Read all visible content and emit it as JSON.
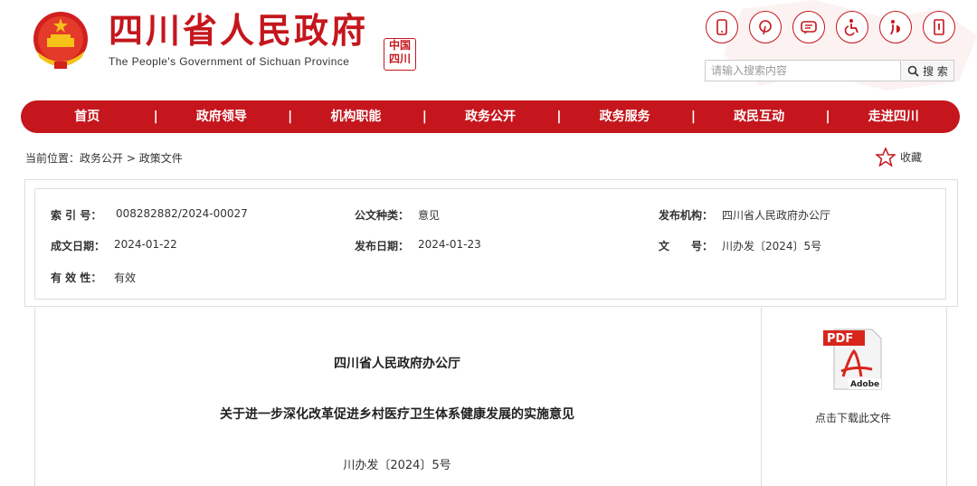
{
  "header": {
    "site_title": "四川省人民政府",
    "site_subtitle": "The People's Government of Sichuan Province",
    "seal_text": "中国四川",
    "icons": [
      "mobile-icon",
      "weibo-icon",
      "wechat-icon",
      "accessibility-icon",
      "elder-care-icon",
      "exit-icon"
    ],
    "search_placeholder": "请输入搜索内容",
    "search_label": "搜 索"
  },
  "nav": {
    "items": [
      "首页",
      "政府领导",
      "机构职能",
      "政务公开",
      "政务服务",
      "政民互动",
      "走进四川"
    ]
  },
  "breadcrumb": {
    "prefix": "当前位置：",
    "level1": "政务公开",
    "separator": " > ",
    "level2": "政策文件"
  },
  "favorite_label": "收藏",
  "meta": {
    "index_label": "索 引 号：",
    "index_value": "008282882/2024-00027",
    "category_label": "公文种类：",
    "category_value": "意见",
    "publisher_label": "发布机构：",
    "publisher_value": "四川省人民政府办公厅",
    "created_label": "成文日期：",
    "created_value": "2024-01-22",
    "published_label": "发布日期：",
    "published_value": "2024-01-23",
    "docno_label": "文　　号：",
    "docno_value": "川办发〔2024〕5号",
    "validity_label": "有 效 性：",
    "validity_value": "有效"
  },
  "document": {
    "issuer": "四川省人民政府办公厅",
    "title": "关于进一步深化改革促进乡村医疗卫生体系健康发展的实施意见",
    "number": "川办发〔2024〕5号"
  },
  "download": {
    "pdf_badge": "PDF",
    "adobe_text": "Adobe",
    "label": "点击下载此文件"
  },
  "colors": {
    "brand_red": "#c5161d"
  }
}
